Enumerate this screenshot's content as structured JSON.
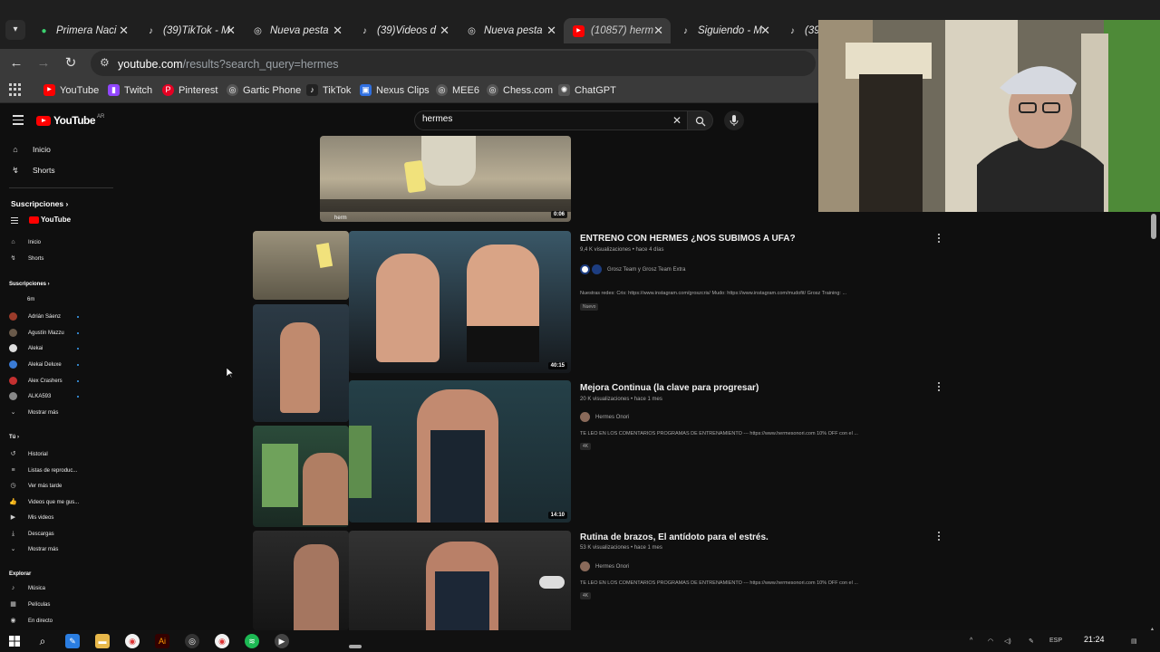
{
  "browser": {
    "tabs": [
      {
        "title": "Primera Naci",
        "icon": "green-globe-icon",
        "active": false
      },
      {
        "title": "(39)TikTok - M",
        "icon": "tiktok-icon",
        "active": false
      },
      {
        "title": "Nueva pesta",
        "icon": "chrome-icon",
        "active": false
      },
      {
        "title": "(39)Videos d",
        "icon": "tiktok-icon",
        "active": false
      },
      {
        "title": "Nueva pesta",
        "icon": "chrome-icon",
        "active": false
      },
      {
        "title": "(10857) herm",
        "icon": "youtube-icon",
        "active": true
      },
      {
        "title": "Siguiendo - M",
        "icon": "tiktok-icon",
        "active": false
      },
      {
        "title": "(39",
        "icon": "tiktok-icon",
        "active": false
      }
    ],
    "url_host": "youtube.com",
    "url_path": "/results?search_query=hermes",
    "bookmarks": [
      {
        "label": "YouTube",
        "icon": "youtube-icon",
        "color": "#ff0000"
      },
      {
        "label": "Twitch",
        "icon": "twitch-icon",
        "color": "#9146ff"
      },
      {
        "label": "Pinterest",
        "icon": "pinterest-icon",
        "color": "#e60023"
      },
      {
        "label": "Gartic Phone",
        "icon": "globe-icon",
        "color": "#555555"
      },
      {
        "label": "TikTok",
        "icon": "tiktok-icon",
        "color": "#222222"
      },
      {
        "label": "Nexus Clips",
        "icon": "nexus-icon",
        "color": "#2f6fe0"
      },
      {
        "label": "MEE6",
        "icon": "globe-icon",
        "color": "#555555"
      },
      {
        "label": "Chess.com",
        "icon": "globe-icon",
        "color": "#555555"
      },
      {
        "label": "ChatGPT",
        "icon": "chatgpt-icon",
        "color": "#555555"
      }
    ]
  },
  "youtube": {
    "logo_text": "YouTube",
    "logo_region": "AR",
    "search_value": "hermes",
    "sidebar_main": [
      {
        "label": "Inicio",
        "icon": "home-icon"
      },
      {
        "label": "Shorts",
        "icon": "shorts-icon"
      }
    ],
    "subscriptions_label": "Suscripciones",
    "nested_logo_text": "YouTube",
    "sidebar_mini": [
      {
        "label": "Inicio",
        "icon": "home-icon"
      },
      {
        "label": "Shorts",
        "icon": "shorts-icon"
      }
    ],
    "subscriptions_mini_label": "Suscripciones",
    "subscriptions": [
      {
        "name": "6m",
        "color": "#202020",
        "dot": false
      },
      {
        "name": "Adrián Sáenz",
        "color": "#9b3b2a",
        "dot": true
      },
      {
        "name": "Agustín Mazzu",
        "color": "#6a5a4a",
        "dot": true
      },
      {
        "name": "Alekai",
        "color": "#dddddd",
        "dot": true
      },
      {
        "name": "Alekai Deluxe",
        "color": "#3a7bd5",
        "dot": true
      },
      {
        "name": "Alex Crashers",
        "color": "#c43030",
        "dot": true
      },
      {
        "name": "ALKA593",
        "color": "#888888",
        "dot": true
      }
    ],
    "show_more": "Mostrar más",
    "you_label": "Tú",
    "you_items": [
      {
        "label": "Historial",
        "icon": "history-icon"
      },
      {
        "label": "Listas de reproduc...",
        "icon": "playlist-icon"
      },
      {
        "label": "Ver más tarde",
        "icon": "clock-icon"
      },
      {
        "label": "Videos que me gus...",
        "icon": "thumbs-up-icon"
      },
      {
        "label": "Mis videos",
        "icon": "video-icon"
      },
      {
        "label": "Descargas",
        "icon": "download-icon"
      },
      {
        "label": "Mostrar más",
        "icon": "chevron-down-icon"
      }
    ],
    "explore_label": "Explorar",
    "explore_items": [
      {
        "label": "Música",
        "icon": "music-icon"
      },
      {
        "label": "Películas",
        "icon": "film-icon"
      },
      {
        "label": "En directo",
        "icon": "live-icon"
      }
    ],
    "top_partial": {
      "duration": "0:06",
      "label_snippet": "herm"
    },
    "results": [
      {
        "title": "ENTRENO CON HERMES ¿NOS SUBIMOS A UFA?",
        "meta": "9,4 K visualizaciones • hace 4 días",
        "channel": "Grosz Team y Grosz Team Extra",
        "description": "Nuestras redes: Cris: https://www.instagram.com/groszcris/ Mudo: https://www.instagram.com/mudofit/ Grosz Training: ...",
        "badge": "Nuevo",
        "duration": "40:15"
      },
      {
        "title": "Mejora Continua (la clave para progresar)",
        "meta": "20 K visualizaciones • hace 1 mes",
        "channel": "Hermes Onori",
        "description": "TE LEO EN LOS COMENTARIOS PROGRAMAS DE ENTRENAMIENTO --- https://www.hermesonori.com 10% OFF con el ...",
        "badge": "4K",
        "duration": "14:10"
      },
      {
        "title": "Rutina de brazos, El antídoto para el estrés.",
        "meta": "53 K visualizaciones • hace 1 mes",
        "channel": "Hermes Onori",
        "description": "TE LEO EN LOS COMENTARIOS PROGRAMAS DE ENTRENAMIENTO --- https://www.hermesonori.com 10% OFF con el ...",
        "badge": "4K",
        "duration": ""
      }
    ]
  },
  "taskbar": {
    "clock": "21:24",
    "lang": "ESP",
    "apps": [
      {
        "icon": "windows-icon"
      },
      {
        "icon": "search-icon"
      },
      {
        "icon": "app-icon"
      },
      {
        "icon": "folder-icon"
      },
      {
        "icon": "chrome-icon"
      },
      {
        "icon": "illustrator-icon"
      },
      {
        "icon": "obs-icon"
      },
      {
        "icon": "chrome-icon"
      },
      {
        "icon": "spotify-icon"
      },
      {
        "icon": "media-player-icon"
      }
    ]
  }
}
